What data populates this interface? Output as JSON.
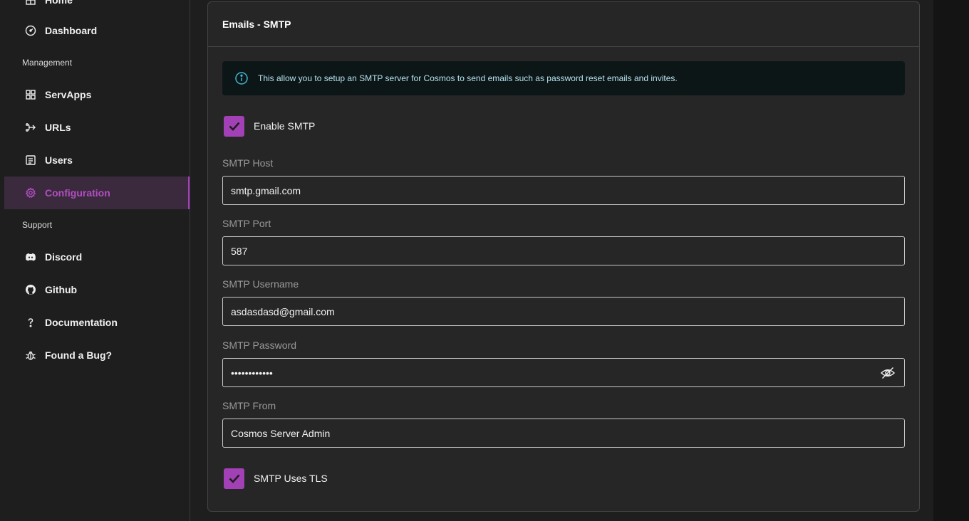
{
  "sidebar": {
    "items": [
      {
        "label": "Home"
      },
      {
        "label": "Dashboard"
      },
      {
        "label": "ServApps"
      },
      {
        "label": "URLs"
      },
      {
        "label": "Users"
      },
      {
        "label": "Configuration"
      },
      {
        "label": "Discord"
      },
      {
        "label": "Github"
      },
      {
        "label": "Documentation"
      },
      {
        "label": "Found a Bug?"
      }
    ],
    "sections": {
      "management": "Management",
      "support": "Support"
    },
    "active_item": "Configuration",
    "accent_color": "#a83fbf"
  },
  "card": {
    "title": "Emails - SMTP",
    "info_text": "This allow you to setup an SMTP server for Cosmos to send emails such as password reset emails and invites.",
    "enable_smtp": {
      "label": "Enable SMTP",
      "checked": true
    },
    "fields": {
      "host": {
        "label": "SMTP Host",
        "value": "smtp.gmail.com"
      },
      "port": {
        "label": "SMTP Port",
        "value": "587"
      },
      "username": {
        "label": "SMTP Username",
        "value": "asdasdasd@gmail.com"
      },
      "password": {
        "label": "SMTP Password",
        "value": "••••••••••••"
      },
      "from": {
        "label": "SMTP From",
        "value": "Cosmos Server Admin"
      }
    },
    "uses_tls": {
      "label": "SMTP Uses TLS",
      "checked": true
    }
  }
}
